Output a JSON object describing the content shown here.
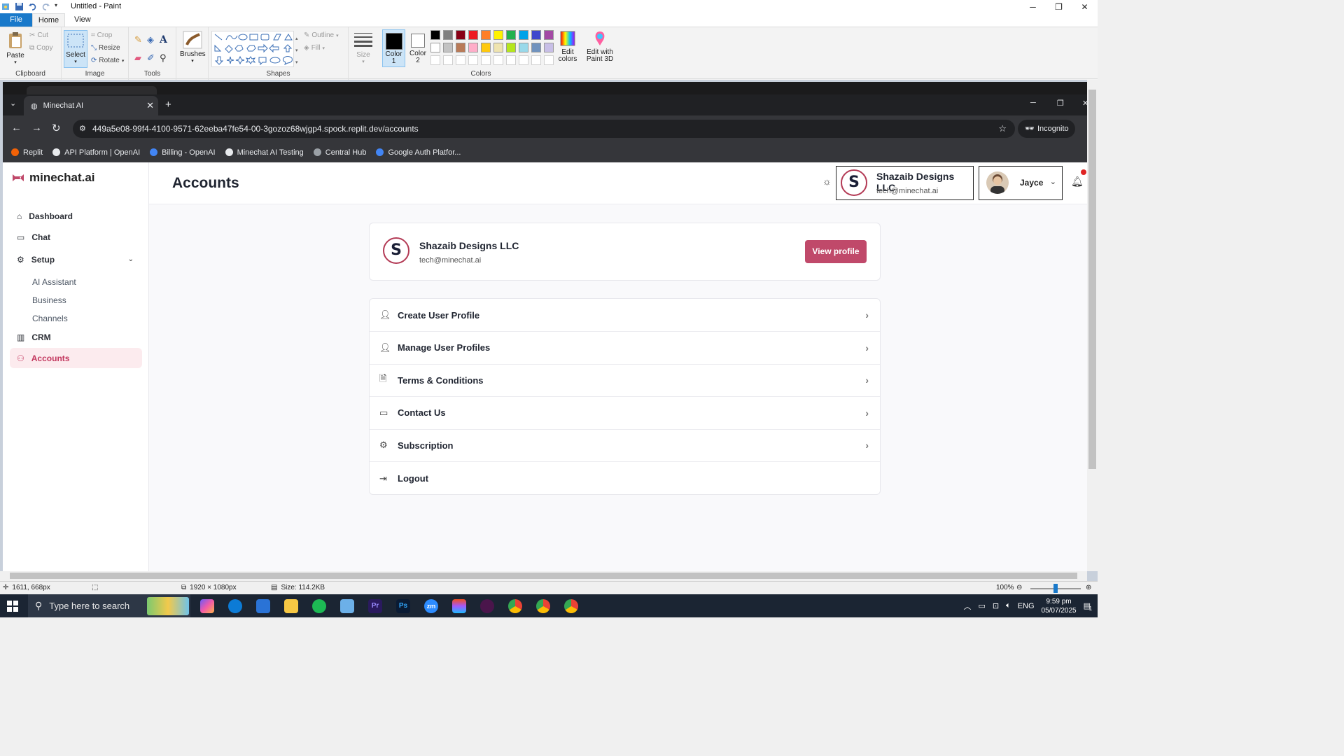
{
  "paint": {
    "title": "Untitled - Paint",
    "tabs": [
      "File",
      "Home",
      "View"
    ],
    "clipboard": {
      "paste": "Paste",
      "cut": "Cut",
      "copy": "Copy",
      "label": "Clipboard"
    },
    "image": {
      "select": "Select",
      "crop": "Crop",
      "resize": "Resize",
      "rotate": "Rotate",
      "label": "Image"
    },
    "tools": {
      "label": "Tools"
    },
    "brushes": "Brushes",
    "shapes": {
      "outline": "Outline",
      "fill": "Fill",
      "label": "Shapes"
    },
    "size": "Size",
    "color1": "Color\n1",
    "color1_line1": "Color",
    "color1_line2": "1",
    "color2_line1": "Color",
    "color2_line2": "2",
    "colors_label": "Colors",
    "edit_colors_line1": "Edit",
    "edit_colors_line2": "colors",
    "paint3d_line1": "Edit with",
    "paint3d_line2": "Paint 3D",
    "palette_row1": [
      "#000000",
      "#7f7f7f",
      "#880015",
      "#ed1c24",
      "#ff7f27",
      "#fff200",
      "#22b14c",
      "#00a2e8",
      "#3f48cc",
      "#a349a4"
    ],
    "palette_row2": [
      "#ffffff",
      "#c3c3c3",
      "#b97a57",
      "#ffaec9",
      "#ffc90e",
      "#efe4b0",
      "#b5e61d",
      "#99d9ea",
      "#7092be",
      "#c8bfe7"
    ],
    "status": {
      "cursor": "1611, 668px",
      "dimensions": "1920 × 1080px",
      "size": "Size: 114.2KB",
      "zoom": "100%"
    }
  },
  "browser": {
    "tab_title": "Minechat AI",
    "url": "449a5e08-99f4-4100-9571-62eeba47fe54-00-3gozoz68wjgp4.spock.replit.dev/accounts",
    "incognito": "Incognito",
    "bookmarks": [
      {
        "label": "Replit",
        "color": "#f26207"
      },
      {
        "label": "API Platform | OpenAI",
        "color": "#e8eaed"
      },
      {
        "label": "Billing - OpenAI",
        "color": "#4285f4"
      },
      {
        "label": "Minechat AI Testing",
        "color": "#e8eaed"
      },
      {
        "label": "Central Hub",
        "color": "#9aa0a6"
      },
      {
        "label": "Google Auth Platfor...",
        "color": "#4285f4"
      }
    ]
  },
  "app": {
    "brand": "minechat.ai",
    "nav": {
      "dashboard": "Dashboard",
      "chat": "Chat",
      "setup": "Setup",
      "ai_assistant": "AI Assistant",
      "business": "Business",
      "channels": "Channels",
      "crm": "CRM",
      "accounts": "Accounts"
    },
    "page_title": "Accounts",
    "business": {
      "name": "Shazaib Designs LLC",
      "email": "tech@minechat.ai"
    },
    "user": {
      "name": "Jayce"
    },
    "profile_card": {
      "name": "Shazaib Designs LLC",
      "email": "tech@minechat.ai",
      "button": "View profile"
    },
    "menu": [
      {
        "label": "Create User Profile",
        "icon": "user-icon"
      },
      {
        "label": "Manage User Profiles",
        "icon": "user-icon"
      },
      {
        "label": "Terms & Conditions",
        "icon": "document-icon"
      },
      {
        "label": "Contact Us",
        "icon": "chat-bubble-icon"
      },
      {
        "label": "Subscription",
        "icon": "gear-icon"
      },
      {
        "label": "Logout",
        "icon": "logout-icon"
      }
    ],
    "accent": "#c0496a"
  },
  "taskbar": {
    "search_placeholder": "Type here to search",
    "language": "ENG",
    "time": "9:59 pm",
    "date": "05/07/2025",
    "notifications": "1"
  }
}
